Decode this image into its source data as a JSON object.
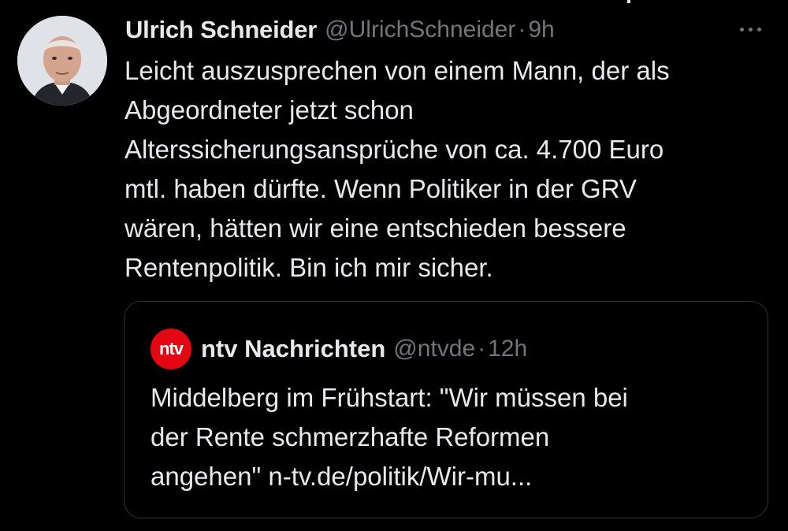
{
  "tweet": {
    "author_name": "Ulrich Schneider",
    "author_handle": "@UlrichSchneider",
    "separator": "·",
    "time": "9h",
    "text": "Leicht auszusprechen von einem Mann, der als\nAbgeordneter jetzt schon\nAlterssicherungsansprüche von ca. 4.700 Euro\nmtl. haben dürfte. Wenn Politiker in der GRV\nwären, hätten wir eine entschieden bessere\nRentenpolitik. Bin ich mir sicher.",
    "more_icon": "more-horizontal-icon"
  },
  "quoted_tweet": {
    "logo_text": "ntv",
    "logo_color": "#e30613",
    "author_name": "ntv Nachrichten",
    "author_handle": "@ntvde",
    "separator": "·",
    "time": "12h",
    "text": "Middelberg im Frühstart: \"Wir müssen bei\nder Rente schmerzhafte Reformen\nangehen\" n-tv.de/politik/Wir-mu..."
  },
  "colors": {
    "background": "#000000",
    "primary_text": "#e7e9ea",
    "secondary_text": "#71767b",
    "border": "#2f3336"
  }
}
